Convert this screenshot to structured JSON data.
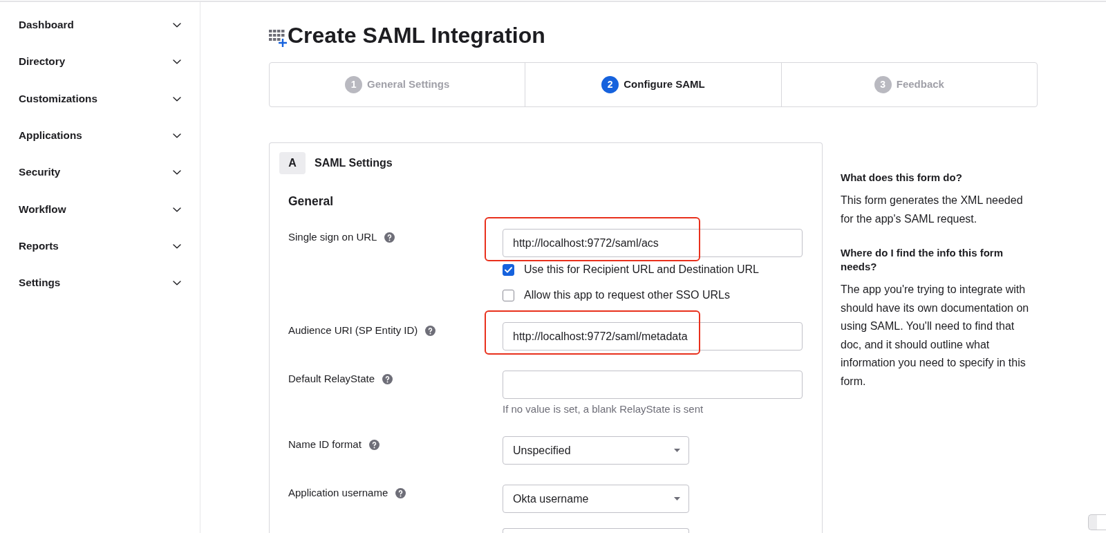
{
  "sidebar": {
    "items": [
      {
        "label": "Dashboard",
        "expanded": false
      },
      {
        "label": "Directory",
        "expanded": false
      },
      {
        "label": "Customizations",
        "expanded": false
      },
      {
        "label": "Applications",
        "expanded": false
      },
      {
        "label": "Security",
        "expanded": false
      },
      {
        "label": "Workflow",
        "expanded": false
      },
      {
        "label": "Reports",
        "expanded": false
      },
      {
        "label": "Settings",
        "expanded": false
      }
    ]
  },
  "header": {
    "title": "Create SAML Integration"
  },
  "steps": [
    {
      "number": "1",
      "label": "General Settings",
      "selected": false
    },
    {
      "number": "2",
      "label": "Configure SAML",
      "selected": true
    },
    {
      "number": "3",
      "label": "Feedback",
      "selected": false
    }
  ],
  "panel": {
    "badge": "A",
    "title": "SAML Settings",
    "group": "General",
    "fields": [
      {
        "kind": "text",
        "label": "Single sign on URL",
        "value": "http://localhost:9772/saml/acs",
        "highlighted": true,
        "options": [
          {
            "label": "Use this for Recipient URL and Destination URL",
            "checked": true
          },
          {
            "label": "Allow this app to request other SSO URLs",
            "checked": false
          }
        ]
      },
      {
        "kind": "text",
        "label": "Audience URI (SP Entity ID)",
        "value": "http://localhost:9772/saml/metadata",
        "highlighted": true
      },
      {
        "kind": "text",
        "label": "Default RelayState",
        "hint": "If no value is set, a blank RelayState is sent",
        "highlighted": false
      },
      {
        "kind": "select",
        "label": "Name ID format",
        "value": "Unspecified",
        "highlighted": false
      },
      {
        "kind": "select",
        "label": "Application username",
        "value": "Okta username",
        "highlighted": false
      },
      {
        "kind": "select",
        "highlighted": false
      }
    ]
  },
  "help": [
    {
      "heading": "What does this form do?",
      "text": "This form generates the XML needed for the app's SAML request."
    },
    {
      "heading": "Where do I find the info this form needs?",
      "text": "The app you're trying to integrate with should have its own documentation on using SAML. You'll need to find that doc, and it should outline what information you need to specify in this form."
    }
  ]
}
